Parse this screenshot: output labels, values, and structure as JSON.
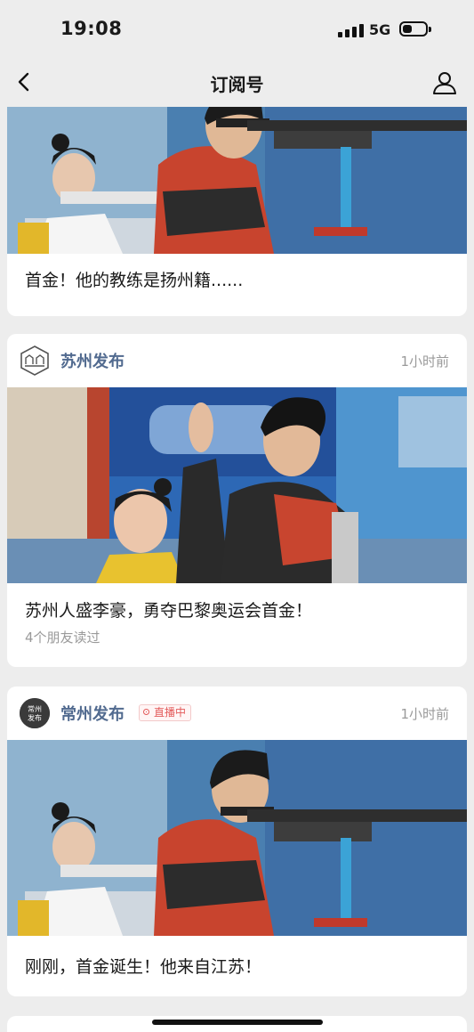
{
  "status_bar": {
    "time": "19:08",
    "network": "5G",
    "battery_level": 0.4
  },
  "nav": {
    "title": "订阅号",
    "back_icon": "chevron-left-icon",
    "profile_icon": "user-icon"
  },
  "cards": [
    {
      "title": "首金！他的教练是扬州籍......"
    },
    {
      "source": "苏州发布",
      "time_ago": "1小时前",
      "title": "苏州人盛李豪，勇夺巴黎奥运会首金！",
      "meta": "4个朋友读过"
    },
    {
      "source": "常州发布",
      "badge": "直播中",
      "time_ago": "1小时前",
      "title": "刚刚，首金诞生！他来自江苏！",
      "avatar_text": [
        "常州",
        "发布"
      ]
    }
  ],
  "colors": {
    "background": "#ededed",
    "card": "#ffffff",
    "source_name": "#516a8f",
    "live_badge": "#e35a5a",
    "muted": "#9a9a9a"
  }
}
